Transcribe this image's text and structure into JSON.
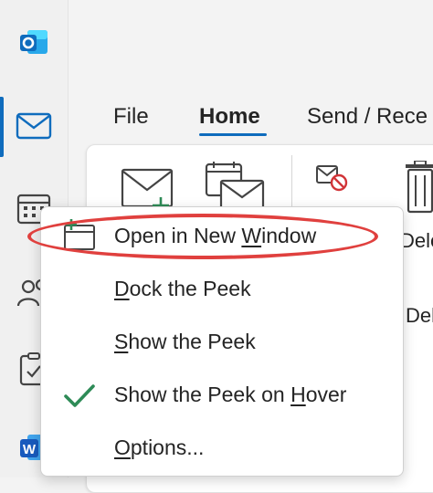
{
  "colors": {
    "accent": "#0f6cbd",
    "outlook_blue": "#0f6cbd",
    "word_blue": "#185abd",
    "check_green": "#2e8b57",
    "highlight_red": "#e0403e"
  },
  "app_rail": {
    "items": [
      {
        "name": "outlook-logo-icon"
      },
      {
        "name": "mail-icon",
        "active": true
      },
      {
        "name": "calendar-icon"
      },
      {
        "name": "people-icon"
      },
      {
        "name": "tasks-icon"
      },
      {
        "name": "word-icon"
      }
    ]
  },
  "ribbon": {
    "tabs": [
      {
        "label": "File",
        "active": false
      },
      {
        "label": "Home",
        "active": true
      },
      {
        "label": "Send / Rece",
        "active": false
      }
    ],
    "partial_labels": {
      "delete_top": "Dele",
      "delete_bottom": "Del"
    }
  },
  "context_menu": {
    "items": [
      {
        "pre": "Open in New ",
        "key": "W",
        "post": "indow",
        "icon": "open-new-window-icon",
        "highlighted": true
      },
      {
        "pre": "",
        "key": "D",
        "post": "ock the Peek",
        "icon": ""
      },
      {
        "pre": "",
        "key": "S",
        "post": "how the Peek",
        "icon": ""
      },
      {
        "pre": "Show the Peek on ",
        "key": "H",
        "post": "over",
        "icon": "checkmark-icon",
        "checked": true
      },
      {
        "pre": "",
        "key": "O",
        "post": "ptions...",
        "icon": ""
      }
    ]
  }
}
